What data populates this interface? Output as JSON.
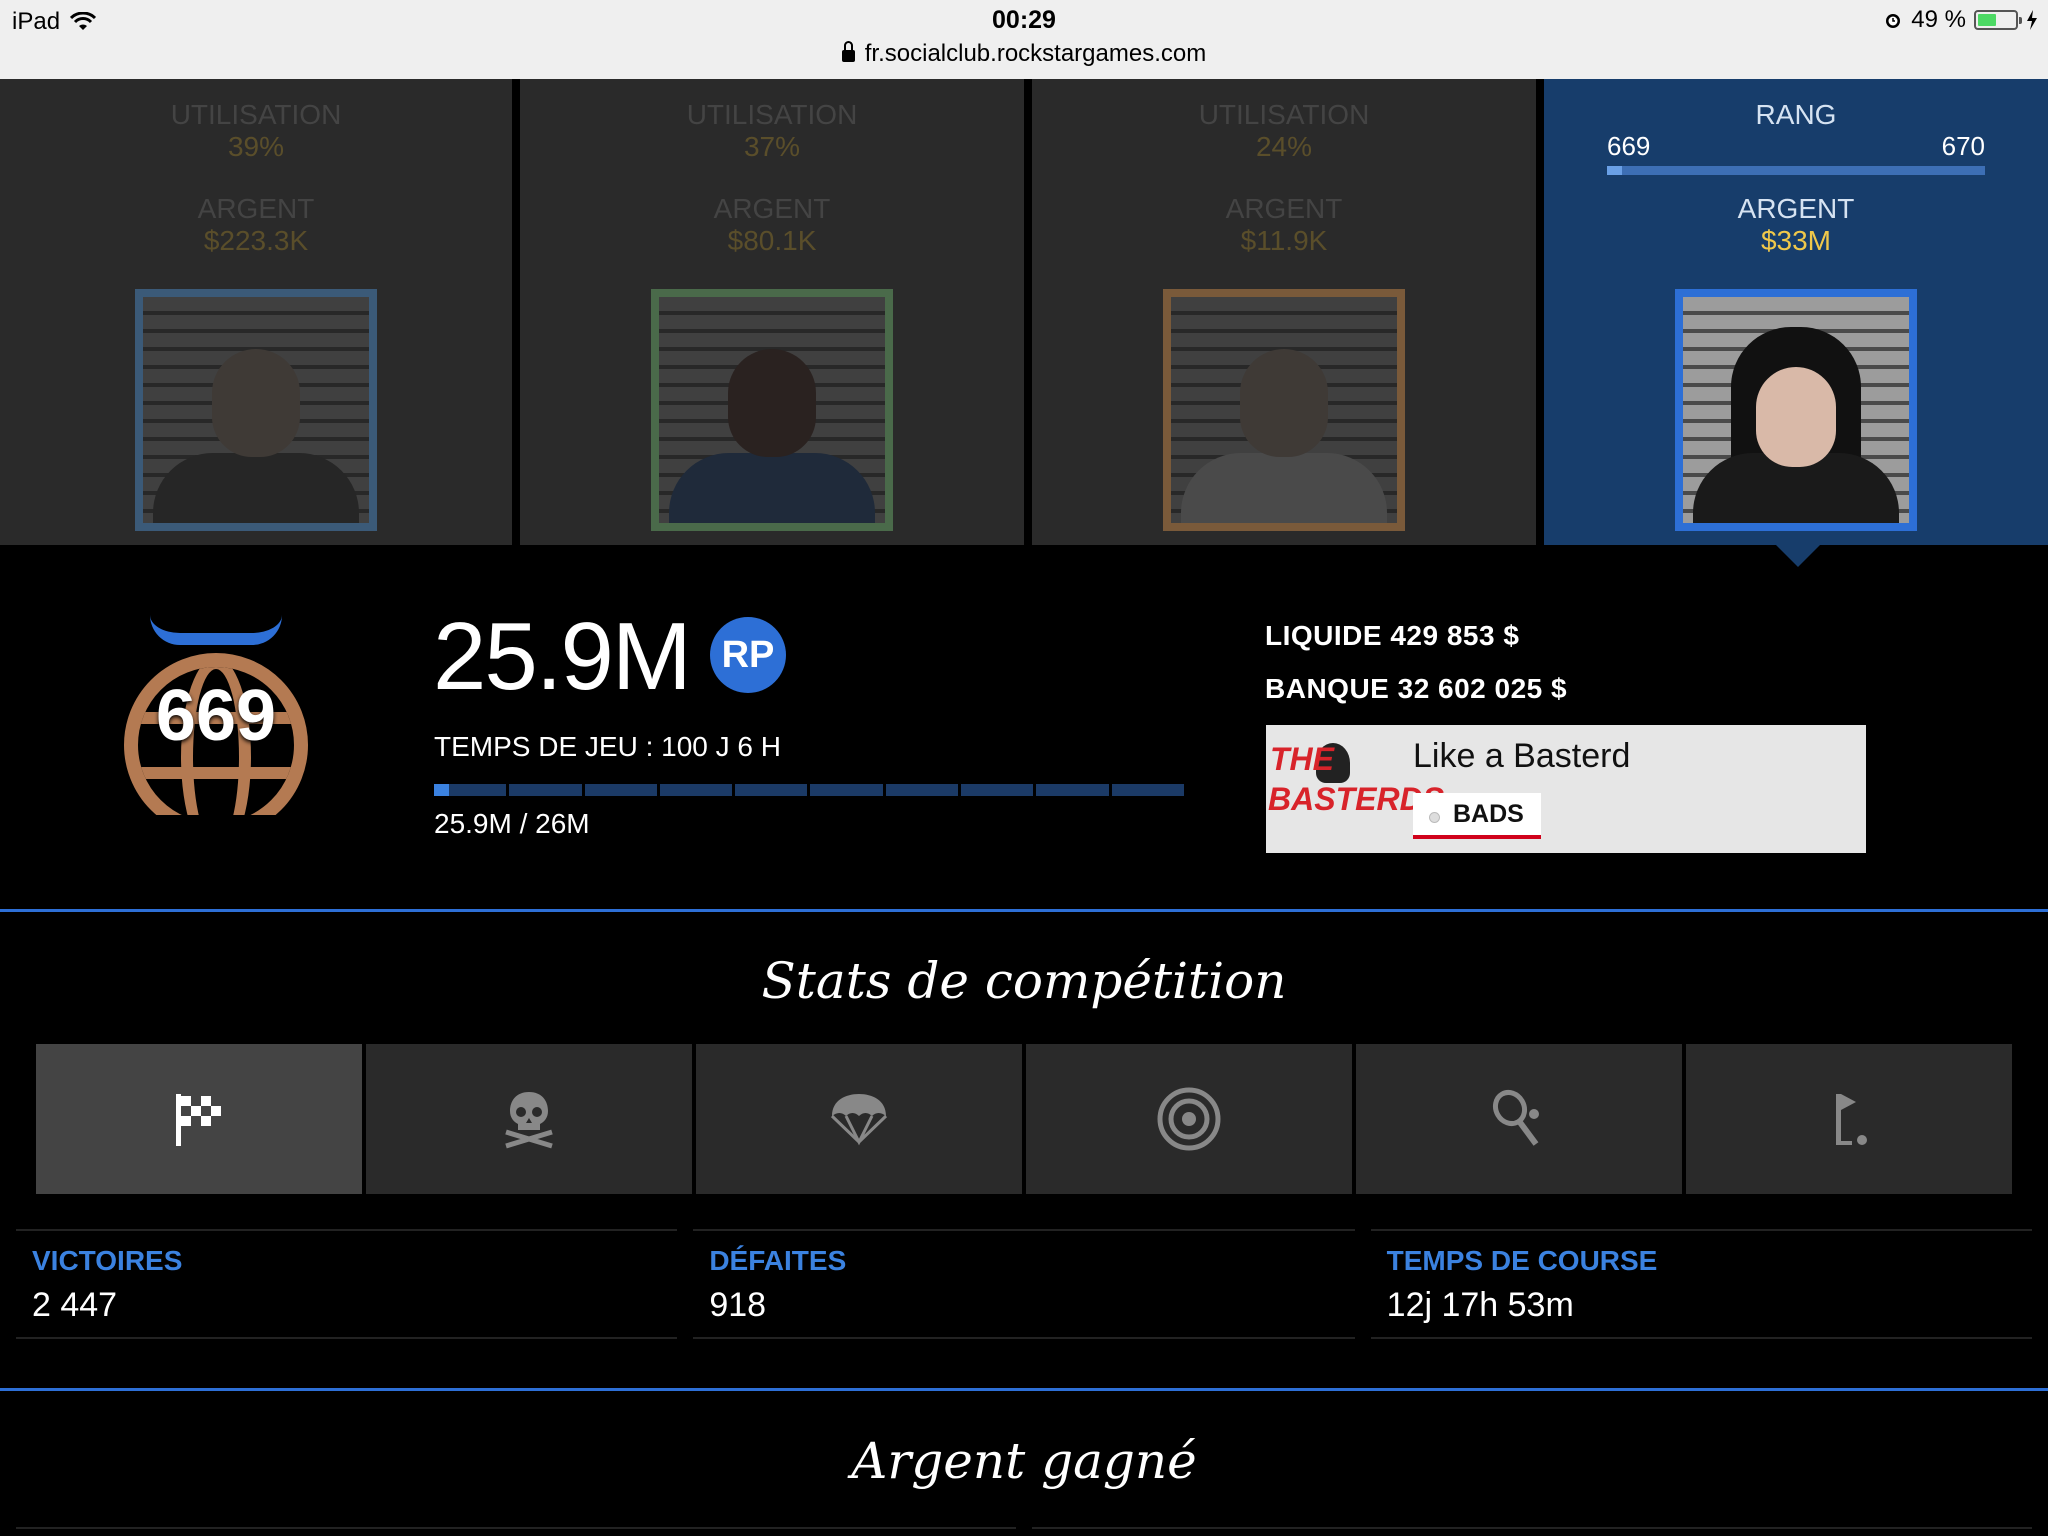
{
  "statusbar": {
    "device": "iPad",
    "time": "00:29",
    "url": "fr.socialclub.rockstargames.com",
    "battery": "49 %",
    "battery_level": 0.49
  },
  "characters": [
    {
      "stat1_label": "UTILISATION",
      "stat1_value": "39%",
      "stat2_label": "ARGENT",
      "stat2_value": "$223.3K",
      "frame_color": "#3b5a78"
    },
    {
      "stat1_label": "UTILISATION",
      "stat1_value": "37%",
      "stat2_label": "ARGENT",
      "stat2_value": "$80.1K",
      "frame_color": "#4a6a4a"
    },
    {
      "stat1_label": "UTILISATION",
      "stat1_value": "24%",
      "stat2_label": "ARGENT",
      "stat2_value": "$11.9K",
      "frame_color": "#7a5a3a"
    },
    {
      "stat1_label": "RANG",
      "rank_from": "669",
      "rank_to": "670",
      "rank_progress": 0.04,
      "stat2_label": "ARGENT",
      "stat2_value": "$33M",
      "frame_color": "#2d6fd6"
    }
  ],
  "profile": {
    "rank": "669",
    "rp": "25.9M",
    "rp_badge": "RP",
    "playtime": "TEMPS DE JEU : 100 J 6 H",
    "xp_text": "25.9M / 26M",
    "xp_segments": 10,
    "cash": "LIQUIDE 429 853 $",
    "bank": "BANQUE 32 602 025 $",
    "crew": {
      "emblem_line1": "THE",
      "emblem_line2": "BASTERDS",
      "name": "Like a Basterd",
      "tag": "BADS"
    }
  },
  "competition": {
    "title": "Stats de compétition",
    "tabs": [
      {
        "icon": "checkered-flag-icon",
        "active": true
      },
      {
        "icon": "skull-crossbones-icon",
        "active": false
      },
      {
        "icon": "parachute-icon",
        "active": false
      },
      {
        "icon": "target-icon",
        "active": false
      },
      {
        "icon": "tennis-racket-icon",
        "active": false
      },
      {
        "icon": "golf-flag-icon",
        "active": false
      }
    ],
    "stats": [
      {
        "label": "VICTOIRES",
        "value": "2 447"
      },
      {
        "label": "DÉFAITES",
        "value": "918"
      },
      {
        "label": "TEMPS DE COURSE",
        "value": "12j 17h 53m"
      }
    ]
  },
  "money_section": {
    "title": "Argent gagné"
  },
  "colors": {
    "accent": "#2d6fd6",
    "money_gold": "#f0c84a",
    "active_card": "#173d6b",
    "crew_red": "#d0021b"
  }
}
